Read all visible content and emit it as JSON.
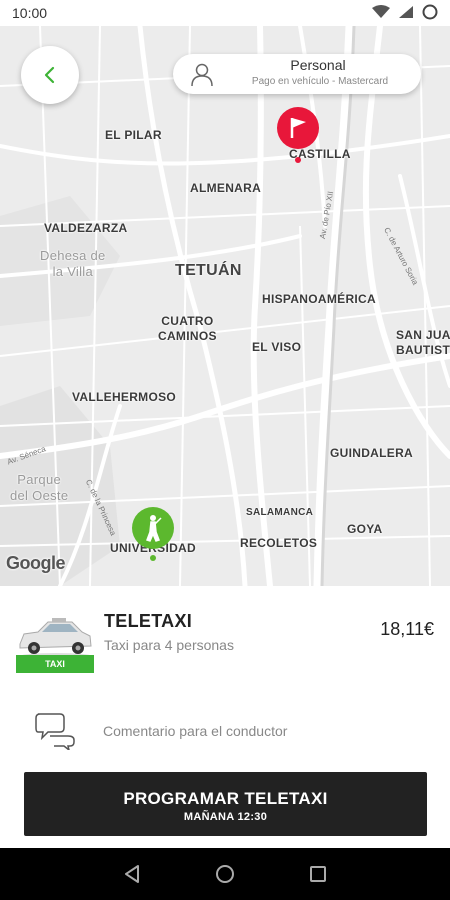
{
  "status_bar": {
    "time": "10:00"
  },
  "profile": {
    "name": "Personal",
    "payment": "Pago en vehículo - Mastercard"
  },
  "map": {
    "labels": {
      "el_pilar": "EL PILAR",
      "castilla": "CASTILLA",
      "almenara": "ALMENARA",
      "valdezarza": "VALDEZARZA",
      "dehesa_line1": "Dehesa de",
      "dehesa_line2": "la Villa",
      "tetuan": "TETUÁN",
      "hispanoamerica": "HISPANOAMÉRICA",
      "cuatro_line1": "CUATRO",
      "cuatro_line2": "CAMINOS",
      "el_viso": "EL VISO",
      "san_juan_line1": "SAN JUA",
      "san_juan_line2": "BAUTIST",
      "vallehermoso": "VALLEHERMOSO",
      "guindalera": "GUINDALERA",
      "parque_line1": "Parque",
      "parque_line2": "del Oeste",
      "salamanca": "SALAMANCA",
      "goya": "GOYA",
      "universidad": "UNIVERSIDAD",
      "recoletos": "RECOLETOS"
    },
    "streets": {
      "pio_xii": "Av. de Pío XII",
      "arturo_soria": "C. de Arturo Soria",
      "moncloa": "C. de la Princesa",
      "reina": "Av. Séneca"
    },
    "attribution": "Google"
  },
  "service": {
    "badge": "TAXI",
    "name": "TELETAXI",
    "description": "Taxi para 4 personas",
    "price": "18,11€"
  },
  "comment": {
    "placeholder": "Comentario para el conductor"
  },
  "cta": {
    "title": "PROGRAMAR TELETAXI",
    "subtitle": "MAÑANA 12:30"
  },
  "colors": {
    "accent_green": "#3db336",
    "destination_red": "#e8173a",
    "button_dark": "#222222"
  }
}
